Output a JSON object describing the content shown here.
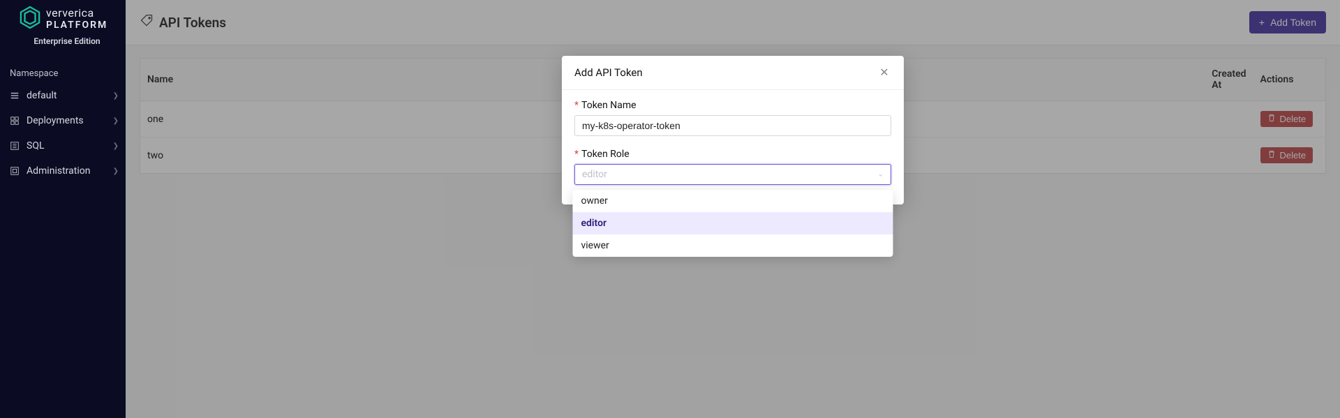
{
  "brand": {
    "name": "ververica",
    "sub": "PLATFORM",
    "edition": "Enterprise Edition"
  },
  "sidebar": {
    "section_label": "Namespace",
    "items": [
      {
        "label": "default"
      },
      {
        "label": "Deployments"
      },
      {
        "label": "SQL"
      },
      {
        "label": "Administration"
      }
    ]
  },
  "header": {
    "title": "API Tokens",
    "add_label": "Add Token"
  },
  "table": {
    "columns": {
      "name": "Name",
      "created": "Created At",
      "actions": "Actions"
    },
    "rows": [
      {
        "name": "one",
        "delete": "Delete"
      },
      {
        "name": "two",
        "delete": "Delete"
      }
    ]
  },
  "modal": {
    "title": "Add API Token",
    "name_label": "Token Name",
    "name_value": "my-k8s-operator-token",
    "role_label": "Token Role",
    "role_placeholder": "editor",
    "options": [
      {
        "label": "owner",
        "selected": false
      },
      {
        "label": "editor",
        "selected": true
      },
      {
        "label": "viewer",
        "selected": false
      }
    ]
  }
}
